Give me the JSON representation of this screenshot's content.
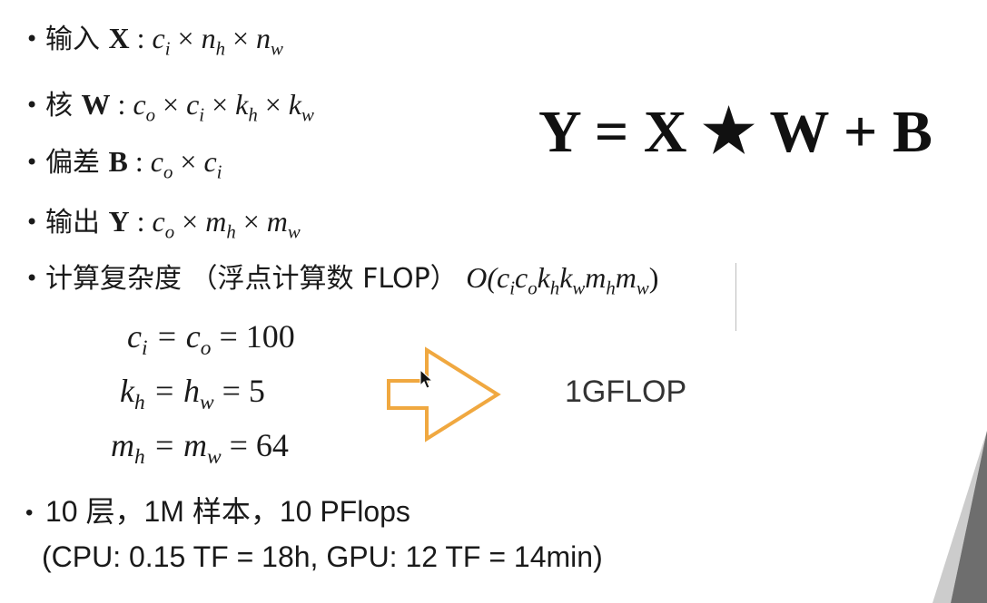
{
  "bullet_glyph": "•",
  "bullets": {
    "input": {
      "label": "输入",
      "sym": "X",
      "colon": " : ",
      "f1": "c",
      "f1s": "i",
      "x1": " × ",
      "f2": "n",
      "f2s": "h",
      "x2": " × ",
      "f3": "n",
      "f3s": "w"
    },
    "kernel": {
      "label": "核",
      "sym": "W",
      "colon": " : ",
      "f1": "c",
      "f1s": "o",
      "x1": " × ",
      "f2": "c",
      "f2s": "i",
      "x2": " × ",
      "f3": "k",
      "f3s": "h",
      "x3": " × ",
      "f4": "k",
      "f4s": "w"
    },
    "bias": {
      "label": "偏差",
      "sym": "B",
      "colon": " : ",
      "f1": "c",
      "f1s": "o",
      "x1": " × ",
      "f2": "c",
      "f2s": "i"
    },
    "output": {
      "label": "输出",
      "sym": "Y",
      "colon": " : ",
      "f1": "c",
      "f1s": "o",
      "x1": " × ",
      "f2": "m",
      "f2s": "h",
      "x2": " × ",
      "f3": "m",
      "f3s": "w"
    },
    "complexity": {
      "label": "计算复杂度 （浮点计算数 FLOP）",
      "O": "O(",
      "a": "c",
      "as": "i",
      "b": "c",
      "bs": "o",
      "c": "k",
      "cs": "h",
      "d": "k",
      "ds": "w",
      "e": "m",
      "es": "h",
      "f": "m",
      "fs": "w",
      "close": ")"
    },
    "layers": "10 层，1M 样本，10 PFlops"
  },
  "equations": {
    "l1": {
      "a": "c",
      "as": "i",
      "b": " = c",
      "bs": "o",
      "rest": " = 100"
    },
    "l2": {
      "a": "k",
      "as": "h",
      "b": " = h",
      "bs": "w",
      "rest": " = 5"
    },
    "l3": {
      "a": "m",
      "as": "h",
      "b": " = m",
      "bs": "w",
      "rest": " = 64"
    }
  },
  "main_formula": {
    "Y": "Y",
    "eq": " = ",
    "X": "X",
    "star": " ★ ",
    "W": "W",
    "plus": " + ",
    "B": "B"
  },
  "result": "1GFLOP",
  "compute_line": "(CPU: 0.15 TF = 18h, GPU: 12 TF = 14min)",
  "colors": {
    "arrow": "#f0a840",
    "text": "#1a1a1a",
    "result": "#333333"
  }
}
